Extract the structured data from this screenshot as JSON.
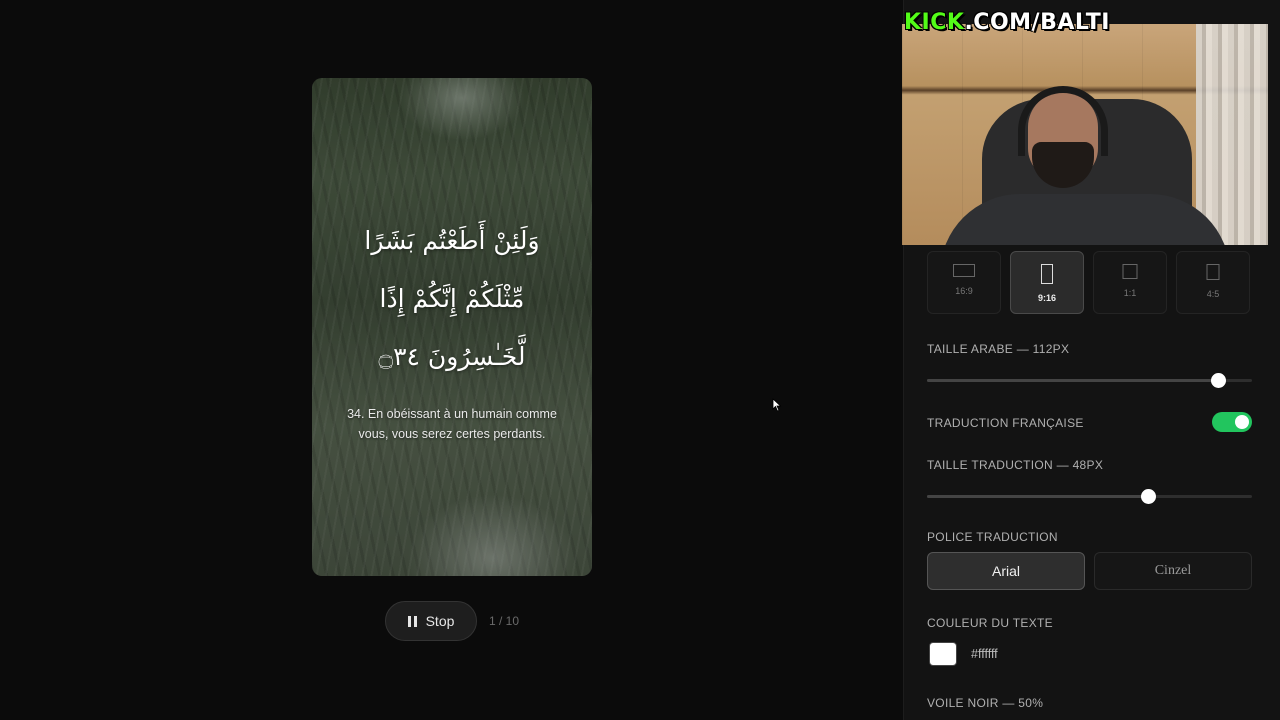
{
  "preview": {
    "arabic_lines": [
      "وَلَئِنْ أَطَعْتُم بَشَرًا",
      "مِّثْلَكُمْ إِنَّكُمْ إِذًا",
      "لَّخَـٰسِرُونَ ۝٣٤"
    ],
    "translation": "34. En obéissant à un humain comme vous, vous serez certes perdants."
  },
  "playback": {
    "stop_label": "Stop",
    "counter": "1 / 10"
  },
  "settings": {
    "aspect_ratios": [
      {
        "label": "16:9",
        "active": false
      },
      {
        "label": "9:16",
        "active": true
      },
      {
        "label": "1:1",
        "active": false
      },
      {
        "label": "4:5",
        "active": false
      }
    ],
    "arabic_size": {
      "label": "TAILLE ARABE — 112PX",
      "value": 112,
      "fraction": 0.895
    },
    "french_translation": {
      "label": "TRADUCTION FRANÇAISE",
      "enabled": true
    },
    "translation_size": {
      "label": "TAILLE TRADUCTION — 48PX",
      "value": 48,
      "fraction": 0.68
    },
    "translation_font": {
      "label": "POLICE TRADUCTION",
      "options": [
        "Arial",
        "Cinzel"
      ],
      "selected": "Arial"
    },
    "text_color": {
      "label": "COULEUR DU TEXTE",
      "value": "#ffffff"
    },
    "black_veil": {
      "label": "VOILE NOIR — 50%",
      "value": 50
    }
  },
  "webcam": {
    "watermark_kick": "KICK",
    "watermark_rest": ".COM/BALTI"
  },
  "colors": {
    "accent_toggle": "#22c55e",
    "kick_green": "#53fc18"
  }
}
